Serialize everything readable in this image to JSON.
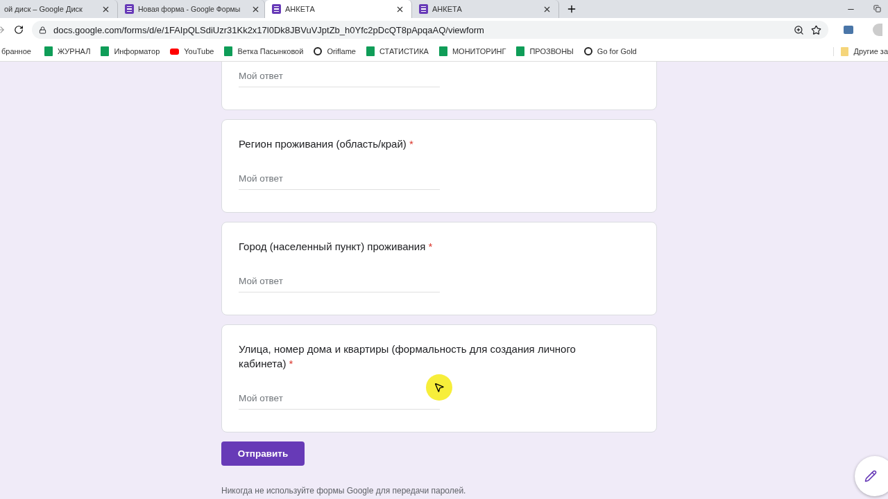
{
  "tabs": [
    {
      "title": "ой диск – Google Диск",
      "kind": "drive",
      "selected": false
    },
    {
      "title": "Новая форма - Google Формы",
      "kind": "forms",
      "selected": false
    },
    {
      "title": "АНКЕТА",
      "kind": "forms",
      "selected": true
    },
    {
      "title": "АНКЕТА",
      "kind": "forms",
      "selected": false
    }
  ],
  "address": "docs.google.com/forms/d/e/1FAIpQLSdiUzr31Kk2x17l0Dk8JBVuVJptZb_h0Yfc2pDcQT8pApqaAQ/viewform",
  "bookmarks": [
    {
      "label": "бранное",
      "kind": "none"
    },
    {
      "label": "ЖУРНАЛ",
      "kind": "sheets"
    },
    {
      "label": "Информатор",
      "kind": "sheets"
    },
    {
      "label": "YouTube",
      "kind": "youtube"
    },
    {
      "label": "Ветка Пасынковой",
      "kind": "sheets"
    },
    {
      "label": "Oriflame",
      "kind": "ring"
    },
    {
      "label": "СТАТИСТИКА",
      "kind": "sheets"
    },
    {
      "label": "МОНИТОРИНГ",
      "kind": "sheets"
    },
    {
      "label": "ПРОЗВОНЫ",
      "kind": "sheets"
    },
    {
      "label": "Go for Gold",
      "kind": "ring"
    }
  ],
  "other_bookmarks": "Другие за",
  "questions": [
    {
      "placeholder": "Мой ответ"
    },
    {
      "title": "Регион проживания (область/край)",
      "required": true,
      "placeholder": "Мой ответ"
    },
    {
      "title": "Город (населенный пункт) проживания",
      "required": true,
      "placeholder": "Мой ответ"
    },
    {
      "title": "Улица, номер дома и квартиры (формальность для создания личного кабинета)",
      "required": true,
      "placeholder": "Мой ответ"
    }
  ],
  "required_mark": "*",
  "submit": "Отправить",
  "footer": "Никогда не используйте формы Google для передачи паролей."
}
